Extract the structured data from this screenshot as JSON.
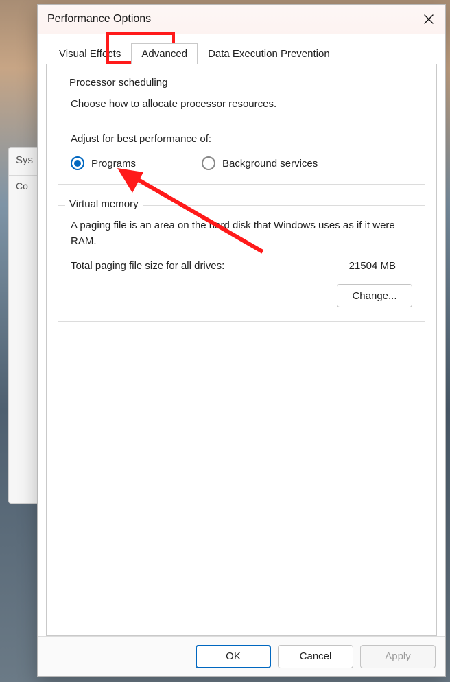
{
  "window": {
    "title": "Performance Options"
  },
  "bg": {
    "header": "Sys",
    "row1": "Co"
  },
  "tabs": {
    "visual_effects": "Visual Effects",
    "advanced": "Advanced",
    "dep": "Data Execution Prevention"
  },
  "processor": {
    "legend": "Processor scheduling",
    "intro": "Choose how to allocate processor resources.",
    "adjust_label": "Adjust for best performance of:",
    "programs_label": "Programs",
    "background_label": "Background services"
  },
  "vm": {
    "legend": "Virtual memory",
    "desc": "A paging file is an area on the hard disk that Windows uses as if it were RAM.",
    "total_label": "Total paging file size for all drives:",
    "total_value": "21504 MB",
    "change_label": "Change..."
  },
  "buttons": {
    "ok": "OK",
    "cancel": "Cancel",
    "apply": "Apply"
  }
}
